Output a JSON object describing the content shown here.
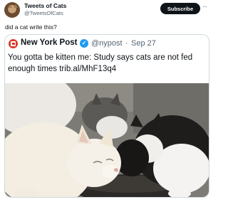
{
  "author": {
    "name": "Tweets of Cats",
    "handle": "@TweetsOfCats",
    "avatar_icon": "cat-avatar-icon"
  },
  "actions": {
    "subscribe_label": "Subscribe",
    "more_label": "···"
  },
  "tweet": {
    "text": "did a cat write this?"
  },
  "quote": {
    "source_name": "New York Post",
    "source_logo": "new-york-post-logo",
    "verified_icon": "verified-check-icon",
    "verified_glyph": "✓",
    "handle": "@nypost",
    "separator": "·",
    "date": "Sep 27",
    "text": "You gotta be kitten me: Study says cats are not fed enough times trib.al/MhF13q4"
  },
  "colors": {
    "background": "#ffffff",
    "text": "#0f1419",
    "secondary_text": "#536471",
    "verified": "#1d9bf0",
    "logo_red": "#d93a2b",
    "subscribe_bg": "#0f1419"
  }
}
